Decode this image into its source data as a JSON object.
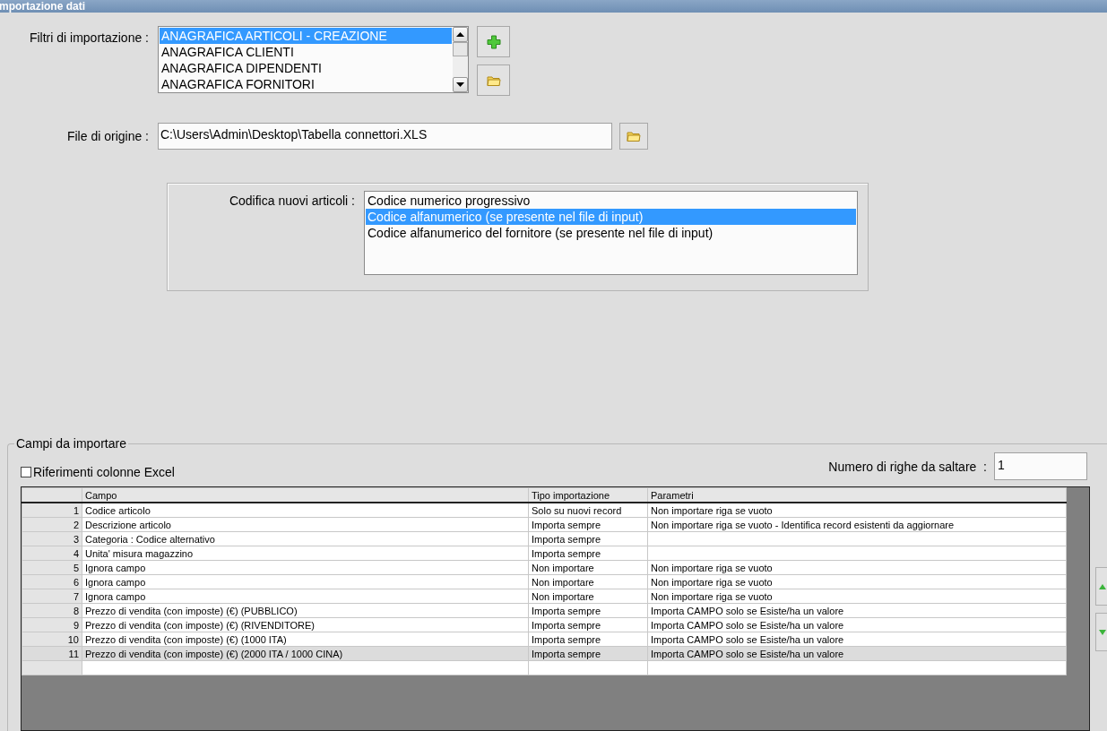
{
  "window": {
    "title": "mportazione dati"
  },
  "filters": {
    "label": "Filtri di importazione :",
    "items": [
      {
        "label": "ANAGRAFICA ARTICOLI - CREAZIONE",
        "selected": true
      },
      {
        "label": "ANAGRAFICA CLIENTI",
        "selected": false
      },
      {
        "label": "ANAGRAFICA DIPENDENTI",
        "selected": false
      },
      {
        "label": "ANAGRAFICA FORNITORI",
        "selected": false
      }
    ]
  },
  "source_file": {
    "label": "File di origine :",
    "value": "C:\\Users\\Admin\\Desktop\\Tabella connettori.XLS"
  },
  "coding": {
    "label": "Codifica nuovi articoli :",
    "options": [
      {
        "label": "Codice numerico progressivo",
        "selected": false
      },
      {
        "label": "Codice alfanumerico (se presente nel file di input)",
        "selected": true
      },
      {
        "label": "Codice alfanumerico del fornitore (se presente nel file di input)",
        "selected": false
      }
    ]
  },
  "fields": {
    "legend": "Campi da importare",
    "excel_refs": {
      "label": "Riferimenti colonne Excel",
      "checked": false
    },
    "skip_rows": {
      "label": "Numero di righe da saltare  :",
      "value": "1"
    },
    "columns": [
      "Campo",
      "Tipo importazione",
      "Parametri"
    ],
    "rows": [
      {
        "number": "1",
        "campo": "Codice articolo",
        "tipo": "Solo su nuovi record",
        "parametri": "Non importare riga se vuoto",
        "selected": false
      },
      {
        "number": "2",
        "campo": "Descrizione articolo",
        "tipo": "Importa sempre",
        "parametri": "Non importare riga se vuoto - Identifica record esistenti da aggiornare",
        "selected": false
      },
      {
        "number": "3",
        "campo": "Categoria : Codice alternativo",
        "tipo": "Importa sempre",
        "selected": false
      },
      {
        "number": "4",
        "campo": "Unita' misura magazzino",
        "tipo": "Importa sempre",
        "selected": false
      },
      {
        "number": "5",
        "campo": "Ignora campo",
        "tipo": "Non importare",
        "parametri": "Non importare riga se vuoto",
        "selected": false
      },
      {
        "number": "6",
        "campo": "Ignora campo",
        "tipo": "Non importare",
        "parametri": "Non importare riga se vuoto",
        "selected": false
      },
      {
        "number": "7",
        "campo": "Ignora campo",
        "tipo": "Non importare",
        "parametri": "Non importare riga se vuoto",
        "selected": false
      },
      {
        "number": "8",
        "campo": "Prezzo di vendita (con imposte) (€) (PUBBLICO)",
        "tipo": "Importa sempre",
        "parametri": "Importa CAMPO solo se Esiste/ha un valore",
        "selected": false
      },
      {
        "number": "9",
        "campo": "Prezzo di vendita (con imposte) (€) (RIVENDITORE)",
        "tipo": "Importa sempre",
        "parametri": "Importa CAMPO solo se Esiste/ha un valore",
        "selected": false
      },
      {
        "number": "10",
        "campo": "Prezzo di vendita (con imposte) (€) (1000 ITA)",
        "tipo": "Importa sempre",
        "parametri": "Importa CAMPO solo se Esiste/ha un valore",
        "selected": false
      },
      {
        "number": "11",
        "campo": "Prezzo di vendita (con imposte) (€) (2000 ITA / 1000 CINA)",
        "tipo": "Importa sempre",
        "parametri": "Importa CAMPO solo se Esiste/ha un valore",
        "selected": true
      }
    ]
  }
}
